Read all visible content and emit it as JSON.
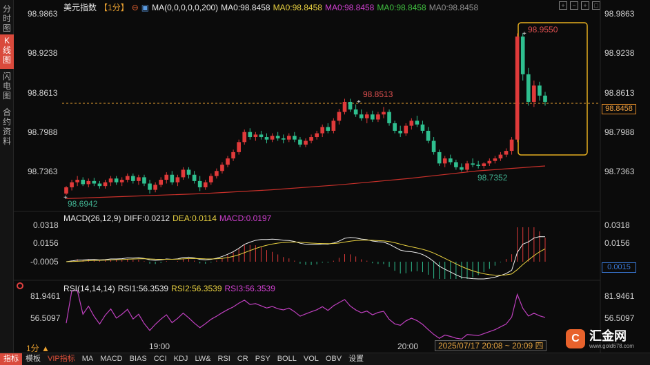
{
  "side_tabs": [
    {
      "label": "分时图",
      "active": false
    },
    {
      "label": "K线图",
      "active": true
    },
    {
      "label": "闪电图",
      "active": false
    },
    {
      "label": "合约资料",
      "active": false
    }
  ],
  "header": {
    "symbol": "美元指数",
    "period": "【1分】",
    "ma_params": "MA(0,0,0,0,0,200)",
    "ma_values": [
      {
        "label": "MA0:98.8458",
        "color": "#e8e8e8"
      },
      {
        "label": "MA0:98.8458",
        "color": "#e8d040"
      },
      {
        "label": "MA0:98.8458",
        "color": "#d040d0"
      },
      {
        "label": "MA0:98.8458",
        "color": "#40c040"
      },
      {
        "label": "MA0:98.8458",
        "color": "#909090"
      }
    ]
  },
  "price_axis": [
    "98.9863",
    "98.9238",
    "98.8613",
    "98.7988",
    "98.7363"
  ],
  "current_price": "98.8458",
  "annotations": {
    "high_mark": "98.9550",
    "local_high": "98.8513",
    "local_low": "98.7352",
    "start_low": "98.6942"
  },
  "macd": {
    "header": "MACD(26,12,9)",
    "diff": "DIFF:0.0212",
    "dea": "DEA:0.0114",
    "macd": "MACD:0.0197",
    "axis": [
      "0.0318",
      "0.0156",
      "-0.0005"
    ],
    "current": "0.0015"
  },
  "rsi": {
    "header": "RSI(14,14,14)",
    "rsi1": "RSI1:56.3539",
    "rsi2": "RSI2:56.3539",
    "rsi3": "RSI3:56.3539",
    "axis": [
      "81.9461",
      "56.5097"
    ]
  },
  "time_axis": [
    "19:00",
    "20:00"
  ],
  "period_label": "1分 ▲",
  "date_range": "2025/07/17 20:08 ~ 20:09 四",
  "bottom_tabs": [
    "指标",
    "模板",
    "VIP指标",
    "MA",
    "MACD",
    "BIAS",
    "CCI",
    "KDJ",
    "LW&",
    "RSI",
    "CR",
    "PSY",
    "BOLL",
    "VOL",
    "OBV",
    "设置"
  ],
  "logo": {
    "name": "汇金网",
    "url": "www.gold678.com",
    "mark": "C"
  },
  "colors": {
    "up": "#e03a3a",
    "down": "#2fbf8f",
    "accent": "#e8a030",
    "ma200": "#c8302a"
  },
  "chart_data": {
    "type": "candlestick",
    "ylim": [
      98.69,
      98.99
    ],
    "candles": [
      [
        98.7,
        98.712,
        98.698,
        98.71
      ],
      [
        98.71,
        98.722,
        98.705,
        98.718
      ],
      [
        98.718,
        98.728,
        98.712,
        98.722
      ],
      [
        98.722,
        98.726,
        98.712,
        98.715
      ],
      [
        98.715,
        98.724,
        98.71,
        98.72
      ],
      [
        98.72,
        98.725,
        98.712,
        98.716
      ],
      [
        98.716,
        98.72,
        98.708,
        98.712
      ],
      [
        98.712,
        98.722,
        98.708,
        98.718
      ],
      [
        98.718,
        98.728,
        98.712,
        98.724
      ],
      [
        98.724,
        98.728,
        98.714,
        98.718
      ],
      [
        98.718,
        98.726,
        98.712,
        98.722
      ],
      [
        98.722,
        98.732,
        98.718,
        98.728
      ],
      [
        98.728,
        98.732,
        98.716,
        98.72
      ],
      [
        98.72,
        98.73,
        98.714,
        98.726
      ],
      [
        98.726,
        98.73,
        98.712,
        98.716
      ],
      [
        98.716,
        98.722,
        98.7,
        98.706
      ],
      [
        98.706,
        98.718,
        98.702,
        98.714
      ],
      [
        98.714,
        98.726,
        98.71,
        98.722
      ],
      [
        98.722,
        98.734,
        98.716,
        98.73
      ],
      [
        98.73,
        98.736,
        98.714,
        98.718
      ],
      [
        98.718,
        98.73,
        98.712,
        98.726
      ],
      [
        98.726,
        98.742,
        98.722,
        98.738
      ],
      [
        98.738,
        98.742,
        98.724,
        98.73
      ],
      [
        98.73,
        98.736,
        98.716,
        98.72
      ],
      [
        98.72,
        98.728,
        98.704,
        98.71
      ],
      [
        98.71,
        98.722,
        98.706,
        98.718
      ],
      [
        98.718,
        98.732,
        98.714,
        98.728
      ],
      [
        98.728,
        98.74,
        98.724,
        98.736
      ],
      [
        98.736,
        98.75,
        98.732,
        98.746
      ],
      [
        98.746,
        98.76,
        98.742,
        98.756
      ],
      [
        98.756,
        98.77,
        98.752,
        98.766
      ],
      [
        98.766,
        98.786,
        98.762,
        98.782
      ],
      [
        98.782,
        98.802,
        98.778,
        98.798
      ],
      [
        98.798,
        98.804,
        98.786,
        98.79
      ],
      [
        98.79,
        98.798,
        98.784,
        98.794
      ],
      [
        98.794,
        98.8,
        98.786,
        98.79
      ],
      [
        98.79,
        98.796,
        98.78,
        98.786
      ],
      [
        98.786,
        98.796,
        98.782,
        98.792
      ],
      [
        98.792,
        98.798,
        98.784,
        98.788
      ],
      [
        98.788,
        98.794,
        98.78,
        98.786
      ],
      [
        98.786,
        98.796,
        98.782,
        98.792
      ],
      [
        98.792,
        98.798,
        98.782,
        98.786
      ],
      [
        98.786,
        98.79,
        98.774,
        98.778
      ],
      [
        98.778,
        98.788,
        98.774,
        98.784
      ],
      [
        98.784,
        98.794,
        98.78,
        98.79
      ],
      [
        98.79,
        98.8,
        98.786,
        98.796
      ],
      [
        98.796,
        98.81,
        98.79,
        98.806
      ],
      [
        98.806,
        98.812,
        98.796,
        98.8
      ],
      [
        98.8,
        98.82,
        98.796,
        98.816
      ],
      [
        98.816,
        98.835,
        98.81,
        98.83
      ],
      [
        98.83,
        98.851,
        98.826,
        98.846
      ],
      [
        98.846,
        98.851,
        98.83,
        98.834
      ],
      [
        98.834,
        98.842,
        98.822,
        98.826
      ],
      [
        98.826,
        98.834,
        98.816,
        98.82
      ],
      [
        98.82,
        98.83,
        98.812,
        98.826
      ],
      [
        98.826,
        98.832,
        98.814,
        98.818
      ],
      [
        98.818,
        98.83,
        98.814,
        98.826
      ],
      [
        98.826,
        98.838,
        98.82,
        98.83
      ],
      [
        98.83,
        98.834,
        98.808,
        98.812
      ],
      [
        98.812,
        98.816,
        98.796,
        98.8
      ],
      [
        98.8,
        98.808,
        98.79,
        98.796
      ],
      [
        98.796,
        98.812,
        98.792,
        98.808
      ],
      [
        98.808,
        98.82,
        98.802,
        98.816
      ],
      [
        98.816,
        98.824,
        98.806,
        98.81
      ],
      [
        98.81,
        98.816,
        98.796,
        98.8
      ],
      [
        98.8,
        98.806,
        98.78,
        98.784
      ],
      [
        98.784,
        98.79,
        98.762,
        98.766
      ],
      [
        98.766,
        98.77,
        98.744,
        98.748
      ],
      [
        98.748,
        98.76,
        98.742,
        98.756
      ],
      [
        98.756,
        98.762,
        98.746,
        98.75
      ],
      [
        98.75,
        98.754,
        98.738,
        98.742
      ],
      [
        98.742,
        98.748,
        98.735,
        98.738
      ],
      [
        98.738,
        98.752,
        98.735,
        98.748
      ],
      [
        98.748,
        98.756,
        98.742,
        98.746
      ],
      [
        98.746,
        98.752,
        98.74,
        98.744
      ],
      [
        98.744,
        98.75,
        98.74,
        98.748
      ],
      [
        98.748,
        98.756,
        98.744,
        98.752
      ],
      [
        98.752,
        98.76,
        98.748,
        98.756
      ],
      [
        98.756,
        98.766,
        98.752,
        98.762
      ],
      [
        98.762,
        98.772,
        98.758,
        98.768
      ],
      [
        98.768,
        98.79,
        98.762,
        98.786
      ],
      [
        98.786,
        98.955,
        98.782,
        98.95
      ],
      [
        98.95,
        98.955,
        98.88,
        98.89
      ],
      [
        98.89,
        98.9,
        98.84,
        98.846
      ],
      [
        98.846,
        98.88,
        98.838,
        98.872
      ],
      [
        98.872,
        98.878,
        98.848,
        98.856
      ],
      [
        98.856,
        98.862,
        98.84,
        98.846
      ]
    ],
    "ma200": [
      98.692,
      98.696,
      98.7,
      98.706,
      98.714,
      98.724,
      98.736,
      98.744
    ]
  }
}
